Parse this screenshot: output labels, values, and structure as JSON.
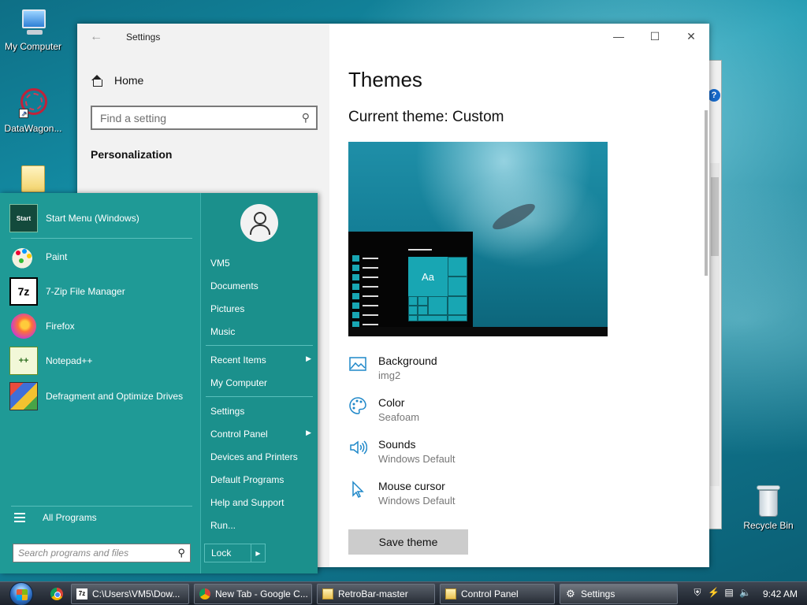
{
  "desktop": {
    "icons": [
      {
        "label": "My Computer",
        "icon": "computer-icon"
      },
      {
        "label": "DataWagon...",
        "icon": "datawagon-icon"
      },
      {
        "label": "Recycle Bin",
        "icon": "recycle-bin-icon"
      }
    ]
  },
  "settings": {
    "window_title": "Settings",
    "home_label": "Home",
    "search_placeholder": "Find a setting",
    "section_label": "Personalization",
    "page_title": "Themes",
    "current_theme": "Current theme: Custom",
    "preview_tile_label": "Aa",
    "options": [
      {
        "title": "Background",
        "value": "img2",
        "icon": "picture-icon"
      },
      {
        "title": "Color",
        "value": "Seafoam",
        "icon": "palette-icon"
      },
      {
        "title": "Sounds",
        "value": "Windows Default",
        "icon": "speaker-icon"
      },
      {
        "title": "Mouse cursor",
        "value": "Windows Default",
        "icon": "cursor-icon"
      }
    ],
    "save_button": "Save theme",
    "controls": {
      "minimize": "—",
      "maximize": "☐",
      "close": "✕"
    }
  },
  "start_menu": {
    "pinned": [
      {
        "label": "Start Menu (Windows)",
        "icon": "start-menu-icon"
      },
      {
        "label": "Paint",
        "icon": "paint-icon"
      },
      {
        "label": "7-Zip File Manager",
        "icon": "7zip-icon"
      },
      {
        "label": "Firefox",
        "icon": "firefox-icon"
      },
      {
        "label": "Notepad++",
        "icon": "notepadpp-icon"
      },
      {
        "label": "Defragment and Optimize Drives",
        "icon": "defrag-icon"
      }
    ],
    "start_icon_text": "Start",
    "sevenzip_icon_text": "7z",
    "notepad_icon_text": "++",
    "all_programs": "All Programs",
    "search_placeholder": "Search programs and files",
    "right_items": {
      "user": "VM5",
      "documents": "Documents",
      "pictures": "Pictures",
      "music": "Music",
      "recent": "Recent Items",
      "computer": "My Computer",
      "settings": "Settings",
      "control_panel": "Control Panel",
      "devices": "Devices and Printers",
      "defaults": "Default Programs",
      "help": "Help and Support",
      "run": "Run..."
    },
    "lock_label": "Lock"
  },
  "taskbar": {
    "buttons": [
      {
        "label": "C:\\Users\\VM5\\Dow...",
        "icon": "7zip-icon"
      },
      {
        "label": "New Tab - Google C...",
        "icon": "chrome-icon"
      },
      {
        "label": "RetroBar-master",
        "icon": "folder-icon"
      },
      {
        "label": "Control Panel",
        "icon": "folder-icon"
      },
      {
        "label": "Settings",
        "icon": "gear-icon"
      }
    ],
    "ic_7z_text": "7z",
    "clock": "9:42 AM"
  },
  "colors": {
    "start_menu_bg": "#1f9a96",
    "accent_icon": "#1f88c9"
  }
}
